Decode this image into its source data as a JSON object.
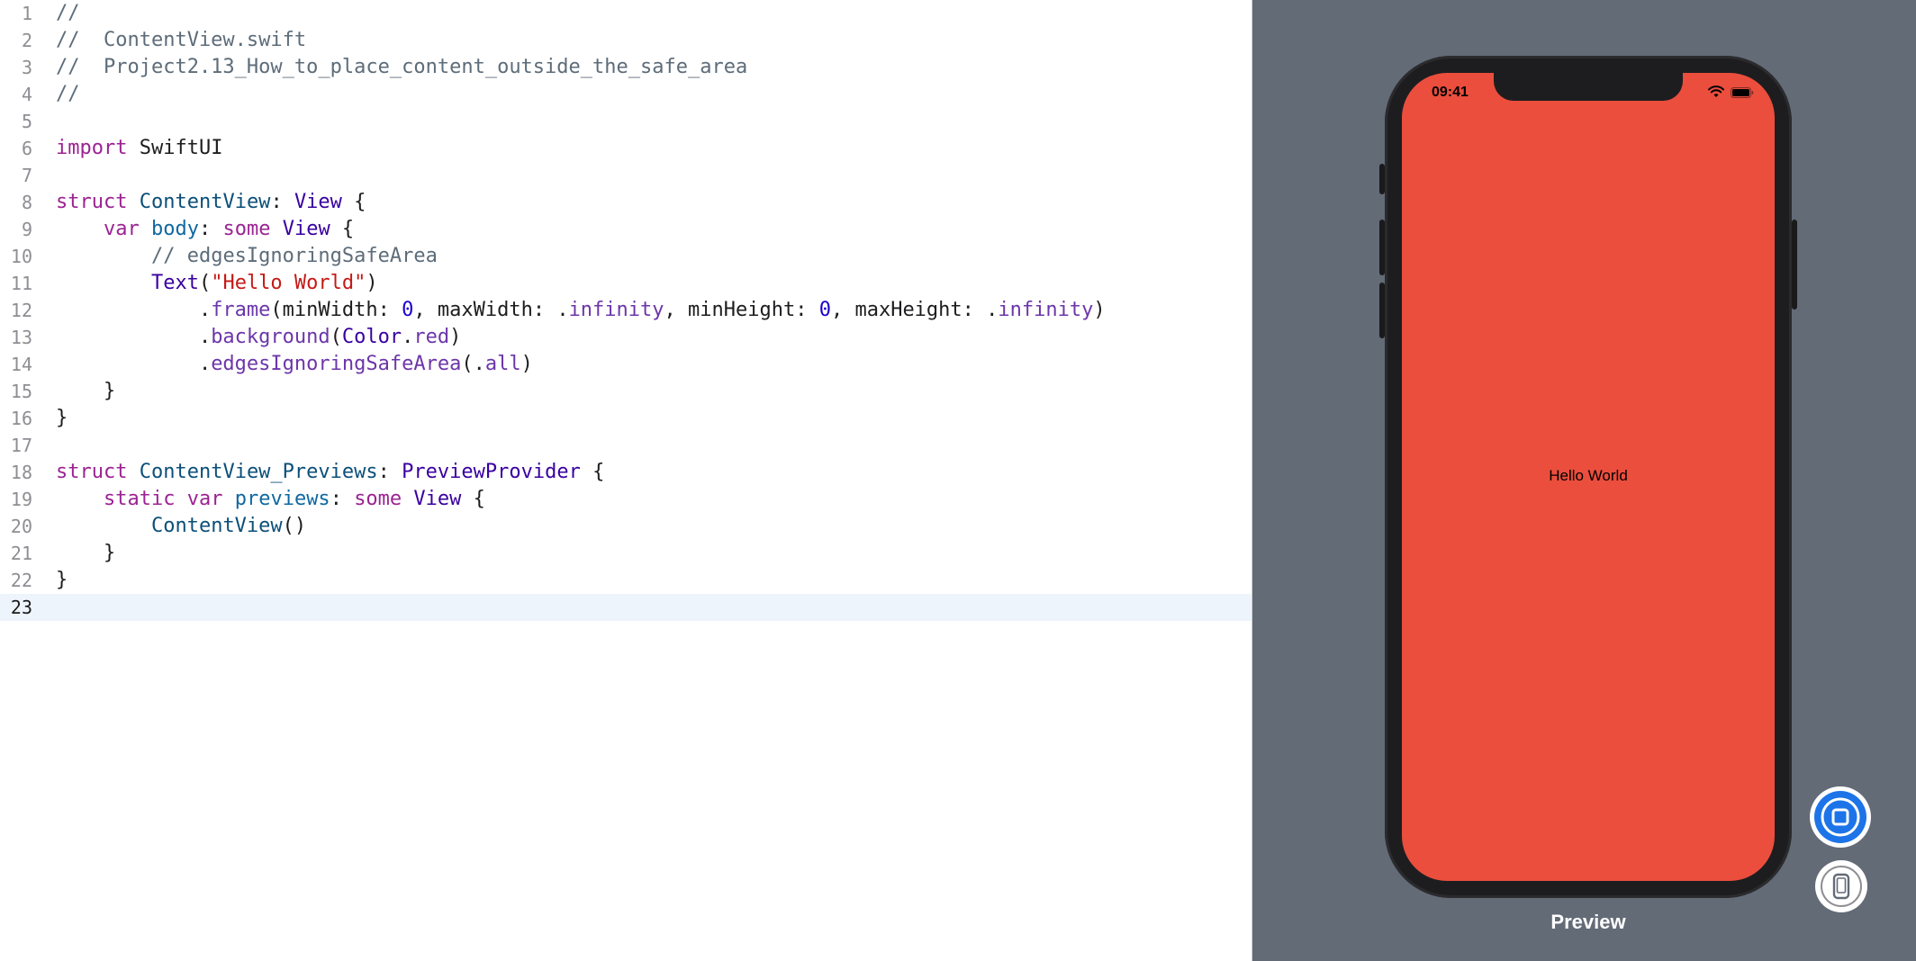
{
  "editor": {
    "lines": [
      {
        "n": "1",
        "tokens": [
          {
            "t": "//",
            "c": "comment"
          }
        ]
      },
      {
        "n": "2",
        "tokens": [
          {
            "t": "//  ContentView.swift",
            "c": "comment"
          }
        ]
      },
      {
        "n": "3",
        "tokens": [
          {
            "t": "//  Project2.13_How_to_place_content_outside_the_safe_area",
            "c": "comment"
          }
        ]
      },
      {
        "n": "4",
        "tokens": [
          {
            "t": "//",
            "c": "comment"
          }
        ]
      },
      {
        "n": "5",
        "tokens": []
      },
      {
        "n": "6",
        "tokens": [
          {
            "t": "import",
            "c": "kw"
          },
          {
            "t": " SwiftUI",
            "c": "plain"
          }
        ]
      },
      {
        "n": "7",
        "tokens": []
      },
      {
        "n": "8",
        "tokens": [
          {
            "t": "struct",
            "c": "kw"
          },
          {
            "t": " ",
            "c": "plain"
          },
          {
            "t": "ContentView",
            "c": "type"
          },
          {
            "t": ": ",
            "c": "plain"
          },
          {
            "t": "View",
            "c": "sysname"
          },
          {
            "t": " {",
            "c": "plain"
          }
        ]
      },
      {
        "n": "9",
        "tokens": [
          {
            "t": "    ",
            "c": "plain"
          },
          {
            "t": "var",
            "c": "kw"
          },
          {
            "t": " ",
            "c": "plain"
          },
          {
            "t": "body",
            "c": "prop"
          },
          {
            "t": ": ",
            "c": "plain"
          },
          {
            "t": "some",
            "c": "kw"
          },
          {
            "t": " ",
            "c": "plain"
          },
          {
            "t": "View",
            "c": "sysname"
          },
          {
            "t": " {",
            "c": "plain"
          }
        ]
      },
      {
        "n": "10",
        "tokens": [
          {
            "t": "        ",
            "c": "plain"
          },
          {
            "t": "// edgesIgnoringSafeArea",
            "c": "comment"
          }
        ]
      },
      {
        "n": "11",
        "tokens": [
          {
            "t": "        ",
            "c": "plain"
          },
          {
            "t": "Text",
            "c": "sysname"
          },
          {
            "t": "(",
            "c": "plain"
          },
          {
            "t": "\"Hello World\"",
            "c": "str"
          },
          {
            "t": ")",
            "c": "plain"
          }
        ]
      },
      {
        "n": "12",
        "tokens": [
          {
            "t": "            .",
            "c": "plain"
          },
          {
            "t": "frame",
            "c": "func"
          },
          {
            "t": "(minWidth: ",
            "c": "plain"
          },
          {
            "t": "0",
            "c": "num"
          },
          {
            "t": ", maxWidth: .",
            "c": "plain"
          },
          {
            "t": "infinity",
            "c": "func"
          },
          {
            "t": ", minHeight: ",
            "c": "plain"
          },
          {
            "t": "0",
            "c": "num"
          },
          {
            "t": ", maxHeight: .",
            "c": "plain"
          },
          {
            "t": "infinity",
            "c": "func"
          },
          {
            "t": ")",
            "c": "plain"
          }
        ]
      },
      {
        "n": "13",
        "tokens": [
          {
            "t": "            .",
            "c": "plain"
          },
          {
            "t": "background",
            "c": "func"
          },
          {
            "t": "(",
            "c": "plain"
          },
          {
            "t": "Color",
            "c": "sysname"
          },
          {
            "t": ".",
            "c": "plain"
          },
          {
            "t": "red",
            "c": "func"
          },
          {
            "t": ")",
            "c": "plain"
          }
        ]
      },
      {
        "n": "14",
        "tokens": [
          {
            "t": "            .",
            "c": "plain"
          },
          {
            "t": "edgesIgnoringSafeArea",
            "c": "func"
          },
          {
            "t": "(.",
            "c": "plain"
          },
          {
            "t": "all",
            "c": "func"
          },
          {
            "t": ")",
            "c": "plain"
          }
        ]
      },
      {
        "n": "15",
        "tokens": [
          {
            "t": "    }",
            "c": "plain"
          }
        ]
      },
      {
        "n": "16",
        "tokens": [
          {
            "t": "}",
            "c": "plain"
          }
        ]
      },
      {
        "n": "17",
        "tokens": []
      },
      {
        "n": "18",
        "tokens": [
          {
            "t": "struct",
            "c": "kw"
          },
          {
            "t": " ",
            "c": "plain"
          },
          {
            "t": "ContentView_Previews",
            "c": "type"
          },
          {
            "t": ": ",
            "c": "plain"
          },
          {
            "t": "PreviewProvider",
            "c": "sysname"
          },
          {
            "t": " {",
            "c": "plain"
          }
        ]
      },
      {
        "n": "19",
        "tokens": [
          {
            "t": "    ",
            "c": "plain"
          },
          {
            "t": "static",
            "c": "kw"
          },
          {
            "t": " ",
            "c": "plain"
          },
          {
            "t": "var",
            "c": "kw"
          },
          {
            "t": " ",
            "c": "plain"
          },
          {
            "t": "previews",
            "c": "prop"
          },
          {
            "t": ": ",
            "c": "plain"
          },
          {
            "t": "some",
            "c": "kw"
          },
          {
            "t": " ",
            "c": "plain"
          },
          {
            "t": "View",
            "c": "sysname"
          },
          {
            "t": " {",
            "c": "plain"
          }
        ]
      },
      {
        "n": "20",
        "tokens": [
          {
            "t": "        ",
            "c": "plain"
          },
          {
            "t": "ContentView",
            "c": "type"
          },
          {
            "t": "()",
            "c": "plain"
          }
        ]
      },
      {
        "n": "21",
        "tokens": [
          {
            "t": "    }",
            "c": "plain"
          }
        ]
      },
      {
        "n": "22",
        "tokens": [
          {
            "t": "}",
            "c": "plain"
          }
        ]
      },
      {
        "n": "23",
        "tokens": [],
        "current": true
      }
    ]
  },
  "preview": {
    "status_time": "09:41",
    "hello_text": "Hello World",
    "label": "Preview",
    "screen_color": "#eb4e3d",
    "pane_color": "#636b77",
    "live_button_icon": "live-preview-icon",
    "device_button_icon": "device-settings-icon"
  }
}
